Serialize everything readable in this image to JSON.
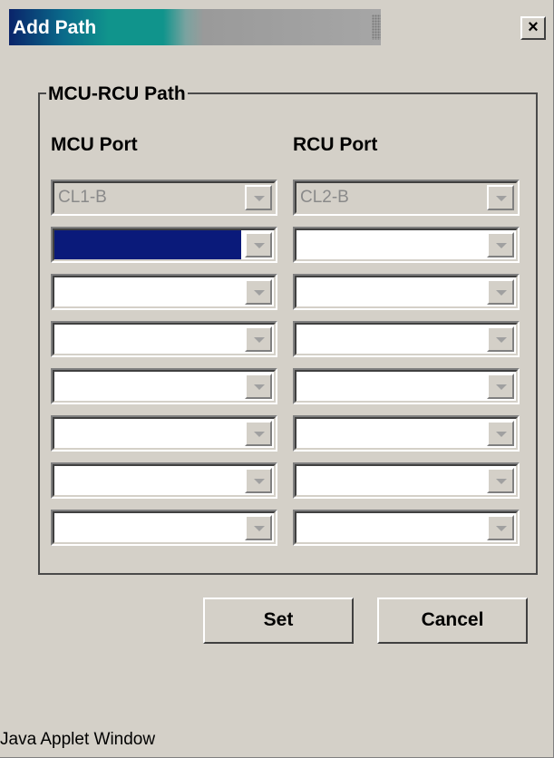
{
  "window": {
    "title": "Add Path",
    "close_glyph": "×",
    "status_text": "Java Applet Window"
  },
  "group": {
    "legend": "MCU-RCU Path",
    "mcu_header": "MCU Port",
    "rcu_header": "RCU Port"
  },
  "rows": [
    {
      "mcu": "CL1-B",
      "rcu": "CL2-B",
      "disabled": true
    },
    {
      "mcu": "",
      "rcu": "",
      "mcu_selected": true
    },
    {
      "mcu": "",
      "rcu": ""
    },
    {
      "mcu": "",
      "rcu": ""
    },
    {
      "mcu": "",
      "rcu": ""
    },
    {
      "mcu": "",
      "rcu": ""
    },
    {
      "mcu": "",
      "rcu": ""
    },
    {
      "mcu": "",
      "rcu": ""
    }
  ],
  "buttons": {
    "set": "Set",
    "cancel": "Cancel"
  },
  "icons": {
    "close": "close-icon",
    "dropdown": "chevron-down-icon"
  },
  "colors": {
    "face": "#d4d0c8",
    "title_start": "#0a246a",
    "title_mid": "#10948c",
    "selection": "#0a1a7a"
  }
}
